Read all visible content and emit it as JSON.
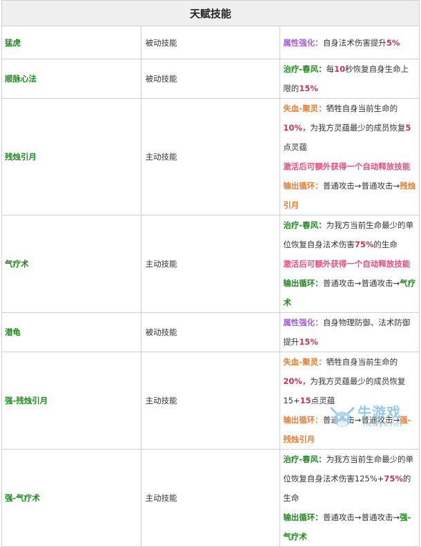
{
  "table": {
    "title": "天赋技能",
    "rows": [
      {
        "name": "猛虎",
        "type": "被动技能",
        "lines": [
          [
            {
              "t": "属性强化：",
              "c": "hl-purple"
            },
            {
              "t": "自身法术伤害提升",
              "c": "plain"
            },
            {
              "t": "5%",
              "c": "hl-red"
            }
          ]
        ]
      },
      {
        "name": "顺脉心法",
        "type": "被动技能",
        "lines": [
          [
            {
              "t": "治疗-春风：",
              "c": "hl-green"
            },
            {
              "t": "每",
              "c": "plain"
            },
            {
              "t": "10",
              "c": "hl-red"
            },
            {
              "t": "秒恢复自身生命上限的",
              "c": "plain"
            },
            {
              "t": "15%",
              "c": "hl-red"
            }
          ]
        ]
      },
      {
        "name": "残烛引月",
        "type": "主动技能",
        "lines": [
          [
            {
              "t": "失血-聚灵：",
              "c": "hl-orange"
            },
            {
              "t": "牺牲自身当前生命的",
              "c": "plain"
            },
            {
              "t": "10%",
              "c": "hl-red"
            },
            {
              "t": "，为我方灵蕴最少的成员恢复",
              "c": "plain"
            },
            {
              "t": "5",
              "c": "hl-red"
            },
            {
              "t": "点灵蕴",
              "c": "plain"
            }
          ],
          [
            {
              "t": "激活后可额外获得一个自动释放技能",
              "c": "hl-pink"
            }
          ],
          [
            {
              "t": "输出循环：",
              "c": "hl-orange"
            },
            {
              "t": "普通攻击→普通攻击→",
              "c": "plain"
            },
            {
              "t": "残烛引月",
              "c": "hl-orange"
            }
          ]
        ]
      },
      {
        "name": "气疗术",
        "type": "主动技能",
        "lines": [
          [
            {
              "t": "治疗-春风：",
              "c": "hl-green"
            },
            {
              "t": "为我方当前生命最少的单位恢复自身法术伤害",
              "c": "plain"
            },
            {
              "t": "75%",
              "c": "hl-red"
            },
            {
              "t": "的生命",
              "c": "plain"
            }
          ],
          [
            {
              "t": "激活后可额外获得一个自动释放技能",
              "c": "hl-pink"
            }
          ],
          [
            {
              "t": "输出循环：",
              "c": "hl-green"
            },
            {
              "t": "普通攻击→普通攻击→",
              "c": "plain"
            },
            {
              "t": "气疗术",
              "c": "hl-green"
            }
          ]
        ]
      },
      {
        "name": "潜龟",
        "type": "被动技能",
        "lines": [
          [
            {
              "t": "属性强化：",
              "c": "hl-purple"
            },
            {
              "t": "自身物理防御、法术防御提升",
              "c": "plain"
            },
            {
              "t": "15%",
              "c": "hl-red"
            }
          ]
        ]
      },
      {
        "name": "强-残烛引月",
        "type": "主动技能",
        "lines": [
          [
            {
              "t": "失血-聚灵：",
              "c": "hl-orange"
            },
            {
              "t": "牺牲自身当前生命的",
              "c": "plain"
            },
            {
              "t": "20%",
              "c": "hl-red"
            },
            {
              "t": "，为我方灵蕴最少的成员恢复15+",
              "c": "plain"
            },
            {
              "t": "15",
              "c": "hl-red"
            },
            {
              "t": "点灵蕴",
              "c": "plain"
            }
          ],
          [
            {
              "t": "输出循环：",
              "c": "hl-orange"
            },
            {
              "t": "普通攻击→普通攻击→",
              "c": "plain"
            },
            {
              "t": "强-残烛引月",
              "c": "hl-orange"
            }
          ]
        ]
      },
      {
        "name": "强-气疗术",
        "type": "主动技能",
        "lines": [
          [
            {
              "t": "治疗-春风：",
              "c": "hl-green"
            },
            {
              "t": "为我方当前生命最少的单位恢复自身法术伤害125%+",
              "c": "plain"
            },
            {
              "t": "75%",
              "c": "hl-red"
            },
            {
              "t": "的生命",
              "c": "plain"
            }
          ],
          [
            {
              "t": "输出循环：",
              "c": "hl-green"
            },
            {
              "t": "普通攻击→普通攻击→",
              "c": "plain"
            },
            {
              "t": "强-气疗术",
              "c": "hl-green"
            }
          ]
        ]
      }
    ]
  },
  "watermark": {
    "text": "牛游戏",
    "sub": "newyx.net",
    "logo": "bull-head-logo",
    "color": "#7fc0ea"
  }
}
